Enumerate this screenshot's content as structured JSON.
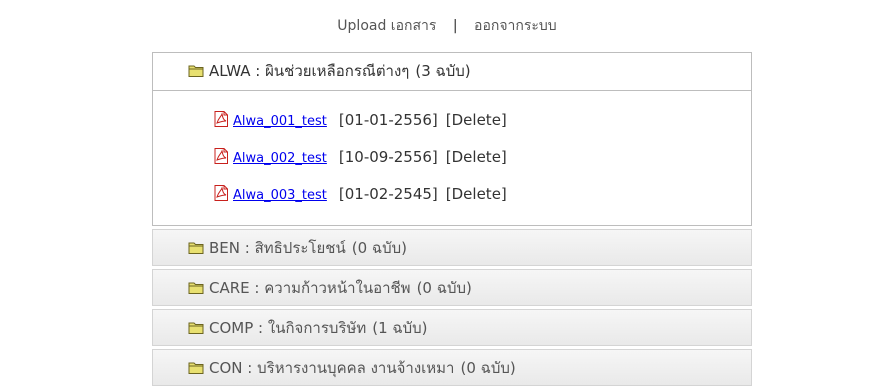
{
  "nav": {
    "upload_label": "Upload เอกสาร",
    "separator": "|",
    "logout_label": "ออกจากระบบ"
  },
  "folders": [
    {
      "code": "ALWA",
      "name": "ผินช่วยเหลือกรณีต่างๆ",
      "count": "(3 ฉบับ)",
      "files": [
        {
          "name": "Alwa_001_test",
          "date": "[01-01-2556]",
          "action": "[Delete]"
        },
        {
          "name": "Alwa_002_test",
          "date": "[10-09-2556]",
          "action": "[Delete]"
        },
        {
          "name": "Alwa_003_test",
          "date": "[01-02-2545]",
          "action": "[Delete]"
        }
      ]
    },
    {
      "code": "BEN",
      "name": "สิทธิประโยชน์",
      "count": "(0 ฉบับ)"
    },
    {
      "code": "CARE",
      "name": "ความก้าวหน้าในอาชีพ",
      "count": "(0 ฉบับ)"
    },
    {
      "code": "COMP",
      "name": "ในกิจการบริษัท",
      "count": "(1 ฉบับ)"
    },
    {
      "code": "CON",
      "name": "บริหารงานบุคคล งานจ้างเหมา",
      "count": "(0 ฉบับ)"
    }
  ],
  "colors": {
    "folder_fill": "#e8e070",
    "pdf_red": "#c8201c"
  },
  "icons": {
    "folder": "folder-icon",
    "pdf": "pdf-file-icon"
  }
}
